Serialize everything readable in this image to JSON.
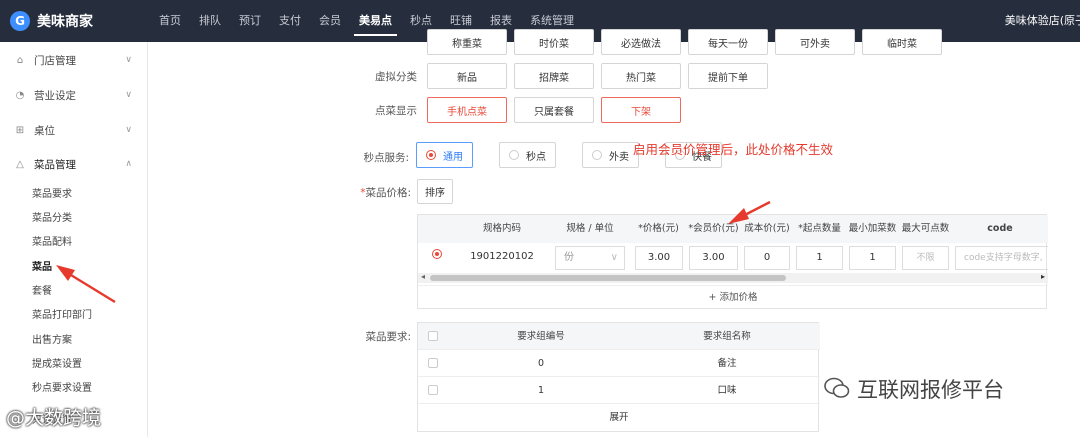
{
  "brand": {
    "logo_glyph": "G",
    "name": "美味商家"
  },
  "nav": {
    "items": [
      "首页",
      "排队",
      "预订",
      "支付",
      "会员",
      "美易点",
      "秒点",
      "旺铺",
      "报表",
      "系统管理"
    ],
    "active_index": 5,
    "shop_name": "美味体验店(原子"
  },
  "sidebar": {
    "groups": [
      {
        "label": "门店管理",
        "icon": "store-icon",
        "glyph": "⌂"
      },
      {
        "label": "营业设定",
        "icon": "business-icon",
        "glyph": "◔"
      },
      {
        "label": "桌位",
        "icon": "table-icon",
        "glyph": "⊞"
      },
      {
        "label": "菜品管理",
        "icon": "dish-icon",
        "glyph": "△"
      }
    ],
    "sub_items": [
      "菜品要求",
      "菜品分类",
      "菜品配料",
      "菜品",
      "套餐",
      "菜品打印部门",
      "出售方案",
      "提成菜设置",
      "秒点要求设置",
      "只读设置"
    ],
    "active_sub": "菜品"
  },
  "form": {
    "top_row_partial": [
      "称重菜",
      "时价菜",
      "必选做法",
      "每天一份",
      "可外卖",
      "临时菜"
    ],
    "virtual_category": {
      "label": "虚拟分类",
      "options": [
        "新品",
        "招牌菜",
        "热门菜",
        "提前下单"
      ]
    },
    "dish_display": {
      "label": "点菜显示",
      "options": [
        "手机点菜",
        "只属套餐",
        "下架"
      ]
    },
    "second_service": {
      "label": "秒点服务:",
      "options": [
        "通用",
        "秒点",
        "外卖",
        "快餐"
      ],
      "selected": "通用"
    },
    "dish_price": {
      "required_mark": "*",
      "label": "菜品价格:",
      "sort_button": "排序"
    }
  },
  "price_table": {
    "headers": [
      "规格内码",
      "规格 / 单位",
      "*价格(元)",
      "*会员价(元)",
      "成本价(元)",
      "*起点数量",
      "最小加菜数",
      "最大可点数",
      "code"
    ],
    "row": {
      "code": "1901220102",
      "unit": "份",
      "price": "3.00",
      "member_price": "3.00",
      "cost_price": "0",
      "start_qty": "1",
      "min_add": "1",
      "max_qty_placeholder": "不限",
      "code_placeholder": "code支持字母数字,"
    },
    "add_price": "+ 添加价格"
  },
  "requirement_table": {
    "label": "菜品要求:",
    "headers": [
      "要求组编号",
      "要求组名称"
    ],
    "rows": [
      {
        "id": "0",
        "name": "备注"
      },
      {
        "id": "1",
        "name": "口味"
      }
    ],
    "expand": "展开"
  },
  "annotation": "启用会员价管理后，此处价格不生效",
  "watermarks": {
    "right": "互联网报修平台",
    "left": "@大数跨境"
  },
  "colors": {
    "topbar": "#262d3c",
    "accent_red": "#e84a3a",
    "accent_blue": "#2f7cf6"
  }
}
